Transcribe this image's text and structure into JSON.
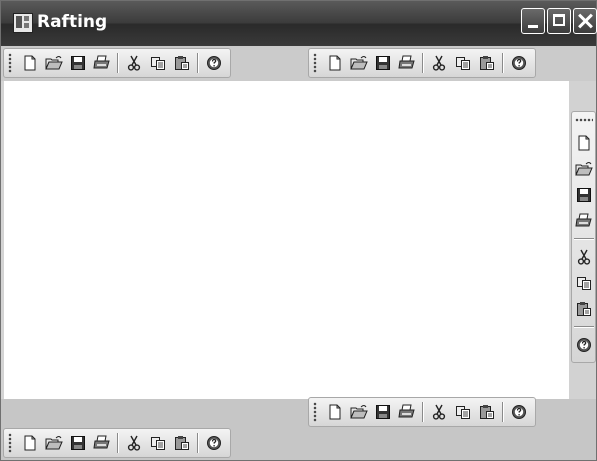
{
  "window": {
    "title": "Rafting",
    "icons": {
      "app": "app-icon",
      "minimize": "minimize-icon",
      "maximize": "maximize-icon",
      "close": "close-icon"
    }
  },
  "toolbar_buttons": [
    "new",
    "open",
    "save",
    "print",
    "cut",
    "copy",
    "paste",
    "help"
  ],
  "toolbars": [
    {
      "id": "toolbar-top-left",
      "orientation": "horizontal"
    },
    {
      "id": "toolbar-top-right",
      "orientation": "horizontal"
    },
    {
      "id": "toolbar-right",
      "orientation": "vertical"
    },
    {
      "id": "toolbar-bottom-right",
      "orientation": "horizontal"
    },
    {
      "id": "toolbar-bottom-left",
      "orientation": "horizontal"
    }
  ],
  "colors": {
    "titlebar": "#3c3c3c",
    "client": "#ffffff",
    "raft_area": "#cbcbcb"
  }
}
